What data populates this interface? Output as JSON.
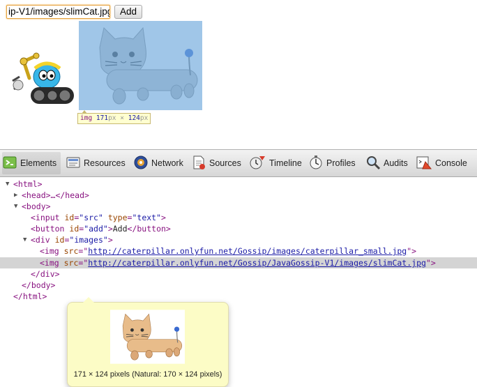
{
  "page": {
    "src_input_value": "ip-V1/images/slimCat.jpg",
    "add_button": "Add"
  },
  "size_tooltip": {
    "tag": "img",
    "width": "171",
    "height": "124",
    "unit": "px",
    "times": "×"
  },
  "devtools": {
    "tabs": [
      {
        "label": "Elements",
        "icon": "elements-icon"
      },
      {
        "label": "Resources",
        "icon": "resources-icon"
      },
      {
        "label": "Network",
        "icon": "network-icon"
      },
      {
        "label": "Sources",
        "icon": "sources-icon"
      },
      {
        "label": "Timeline",
        "icon": "timeline-icon"
      },
      {
        "label": "Profiles",
        "icon": "profiles-icon"
      },
      {
        "label": "Audits",
        "icon": "audits-icon"
      },
      {
        "label": "Console",
        "icon": "console-icon"
      }
    ],
    "selected_tab": "Elements",
    "dom": {
      "html_open": "<html>",
      "head": "<head>…</head>",
      "body_open": "<body>",
      "input": {
        "open": "<input ",
        "a1": "id",
        "v1": "\"src\"",
        "a2": "type",
        "v2": "\"text\"",
        "close": ">"
      },
      "button": {
        "open": "<button ",
        "a1": "id",
        "v1": "\"add\"",
        "close": ">",
        "text": "Add",
        "end": "</button>"
      },
      "div": {
        "open": "<div ",
        "a1": "id",
        "v1": "\"images\"",
        "close": ">"
      },
      "img1": {
        "open": "<img ",
        "a1": "src",
        "q1": "=\"",
        "url": "http://caterpillar.onlyfun.net/Gossip/images/caterpillar_small.jpg",
        "q2": "\"",
        "close": ">"
      },
      "img2": {
        "open": "<img ",
        "a1": "src",
        "q1": "=\"",
        "url": "http://caterpillar.onlyfun.net/Gossip/JavaGossip-V1/images/slimCat.jpg",
        "q2": "\"",
        "close": ">"
      },
      "div_close": "</div>",
      "body_close": "</body>",
      "html_close": "</html>"
    },
    "popover_caption": "171 × 124 pixels (Natural: 170 × 124 pixels)"
  }
}
